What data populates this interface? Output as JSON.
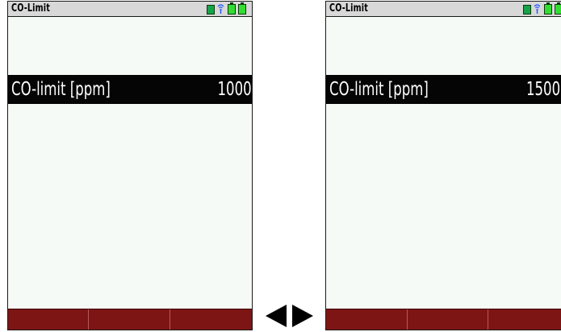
{
  "colors": {
    "screen_bg": "#f6faf6",
    "titlebar_bg": "#d8d8d8",
    "value_row_bg": "#050505",
    "softkey_bg": "#7e1515",
    "battery_green": "#33dd33",
    "card_green": "#16a34a",
    "wireless_blue": "#2255ff"
  },
  "left_screen": {
    "title": "CO-Limit",
    "status_icons": [
      "sd-card-icon",
      "wireless-icon",
      "battery-icon",
      "battery-icon"
    ],
    "row": {
      "label": "CO-limit [ppm]",
      "value": "1000"
    },
    "softkeys": [
      "",
      "",
      ""
    ]
  },
  "right_screen": {
    "title": "CO-Limit",
    "status_icons": [
      "sd-card-icon",
      "wireless-icon",
      "battery-icon",
      "battery-icon"
    ],
    "row": {
      "label": "CO-limit [ppm]",
      "value": "1500"
    },
    "softkeys": [
      "",
      "",
      ""
    ]
  },
  "navigation": {
    "icons": [
      "arrow-left-icon",
      "arrow-right-icon"
    ]
  }
}
